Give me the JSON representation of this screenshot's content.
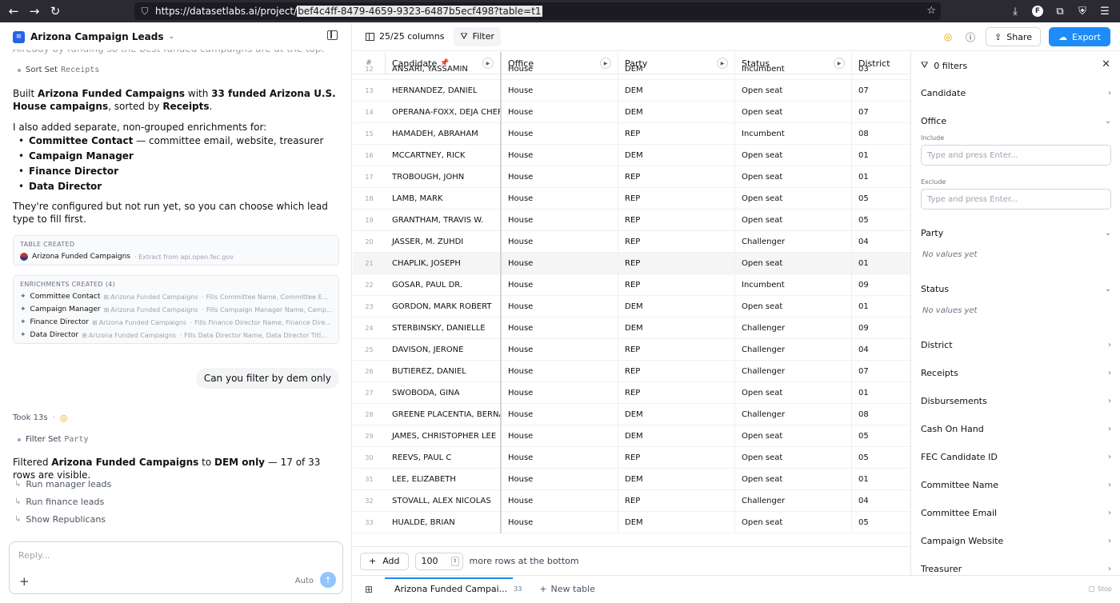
{
  "browser": {
    "url_prefix": "https://datasetlabs.ai/project/",
    "url_selected": "bef4c4ff-8479-4659-9323-6487b5ecf498?table=t1",
    "profile_initial": "F"
  },
  "project": {
    "title": "Arizona Campaign Leads"
  },
  "chat": {
    "faded_line": "Already by funding so the best funded campaigns are at the top.",
    "sort_tool": {
      "label": "Sort Set",
      "arg": "Receipts"
    },
    "built_pre": "Built ",
    "built_table": "Arizona Funded Campaigns",
    "built_mid": " with ",
    "built_count": "33 funded Arizona U.S. House campaigns",
    "built_mid2": ", sorted by ",
    "built_sort": "Receipts",
    "built_end": ".",
    "enrich_intro": "I also added separate, non-grouped enrichments for:",
    "bullets": [
      {
        "bold": "Committee Contact",
        "rest": " — committee email, website, treasurer"
      },
      {
        "bold": "Campaign Manager",
        "rest": ""
      },
      {
        "bold": "Finance Director",
        "rest": ""
      },
      {
        "bold": "Data Director",
        "rest": ""
      }
    ],
    "configured_note": "They're configured but not run yet, so you can choose which lead type to fill first.",
    "table_created": {
      "label": "TABLE CREATED",
      "name": "Arizona Funded Campaigns",
      "meta": "· Extract from api.open.fec.gov"
    },
    "enrichments": {
      "label": "ENRICHMENTS CREATED (4)",
      "items": [
        {
          "name": "Committee Contact",
          "table": "Arizona Funded Campaigns",
          "meta": "· Fills Committee Name, Committee E..."
        },
        {
          "name": "Campaign Manager",
          "table": "Arizona Funded Campaigns",
          "meta": "· Fills Campaign Manager Name, Camp..."
        },
        {
          "name": "Finance Director",
          "table": "Arizona Funded Campaigns",
          "meta": "· Fills Finance Director Name, Finance Dire..."
        },
        {
          "name": "Data Director",
          "table": "Arizona Funded Campaigns",
          "meta": "· Fills Data Director Name, Data Director Titl..."
        }
      ]
    },
    "user_message": "Can you filter by dem only",
    "took": "Took 13s",
    "filter_tool": {
      "label": "Filter Set",
      "arg": "Party"
    },
    "filtered_pre": "Filtered ",
    "filtered_table": "Arizona Funded Campaigns",
    "filtered_mid": " to ",
    "filtered_value": "DEM only",
    "filtered_end": " — 17 of 33 rows are visible.",
    "suggestions": [
      "Run manager leads",
      "Run finance leads",
      "Show Republicans"
    ],
    "reply_placeholder": "Reply...",
    "mode": "Auto"
  },
  "toolbar": {
    "columns_label": "25/25 columns",
    "filter_label": "Filter",
    "share_label": "Share",
    "export_label": "Export"
  },
  "table": {
    "headers": [
      "#",
      "Candidate",
      "Office",
      "Party",
      "Status",
      "District"
    ],
    "rows": [
      [
        "12",
        "ANSARI, YASSAMIN",
        "House",
        "DEM",
        "Incumbent",
        "03"
      ],
      [
        "13",
        "HERNANDEZ, DANIEL",
        "House",
        "DEM",
        "Open seat",
        "07"
      ],
      [
        "14",
        "OPERANA-FOXX, DEJA CHERIE",
        "House",
        "DEM",
        "Open seat",
        "07"
      ],
      [
        "15",
        "HAMADEH, ABRAHAM",
        "House",
        "REP",
        "Incumbent",
        "08"
      ],
      [
        "16",
        "MCCARTNEY, RICK",
        "House",
        "DEM",
        "Open seat",
        "01"
      ],
      [
        "17",
        "TROBOUGH, JOHN",
        "House",
        "REP",
        "Open seat",
        "01"
      ],
      [
        "18",
        "LAMB, MARK",
        "House",
        "REP",
        "Open seat",
        "05"
      ],
      [
        "19",
        "GRANTHAM, TRAVIS W.",
        "House",
        "REP",
        "Open seat",
        "05"
      ],
      [
        "20",
        "JASSER, M. ZUHDI",
        "House",
        "REP",
        "Challenger",
        "04"
      ],
      [
        "21",
        "CHAPLIK, JOSEPH",
        "House",
        "REP",
        "Open seat",
        "01"
      ],
      [
        "22",
        "GOSAR, PAUL DR.",
        "House",
        "REP",
        "Incumbent",
        "09"
      ],
      [
        "23",
        "GORDON, MARK ROBERT",
        "House",
        "DEM",
        "Open seat",
        "01"
      ],
      [
        "24",
        "STERBINSKY, DANIELLE",
        "House",
        "DEM",
        "Challenger",
        "09"
      ],
      [
        "25",
        "DAVISON, JERONE",
        "House",
        "REP",
        "Challenger",
        "04"
      ],
      [
        "26",
        "BUTIEREZ, DANIEL",
        "House",
        "REP",
        "Challenger",
        "07"
      ],
      [
        "27",
        "SWOBODA, GINA",
        "House",
        "REP",
        "Open seat",
        "01"
      ],
      [
        "28",
        "GREENE PLACENTIA, BERNADETTE",
        "House",
        "DEM",
        "Challenger",
        "08"
      ],
      [
        "29",
        "JAMES, CHRISTOPHER LEE",
        "House",
        "DEM",
        "Open seat",
        "05"
      ],
      [
        "30",
        "REEVS, PAUL C",
        "House",
        "REP",
        "Open seat",
        "05"
      ],
      [
        "31",
        "LEE, ELIZABETH",
        "House",
        "DEM",
        "Open seat",
        "01"
      ],
      [
        "32",
        "STOVALL, ALEX NICOLAS",
        "House",
        "REP",
        "Challenger",
        "04"
      ],
      [
        "33",
        "HUALDE, BRIAN",
        "House",
        "DEM",
        "Open seat",
        "05"
      ]
    ],
    "highlighted_row": "21"
  },
  "footer": {
    "add_label": "Add",
    "count_value": "100",
    "more_text": "more rows at the bottom"
  },
  "tabs": {
    "active_label": "Arizona Funded Campai...",
    "active_count": "33",
    "new_tab": "New table",
    "stop": "Stop"
  },
  "filters": {
    "title": "0 filters",
    "include_label": "Include",
    "exclude_label": "Exclude",
    "input_placeholder": "Type and press Enter...",
    "no_values": "No values yet",
    "sections": [
      "Candidate",
      "Office",
      "Party",
      "Status",
      "District",
      "Receipts",
      "Disbursements",
      "Cash On Hand",
      "FEC Candidate ID",
      "Committee Name",
      "Committee Email",
      "Campaign Website",
      "Treasurer"
    ]
  }
}
